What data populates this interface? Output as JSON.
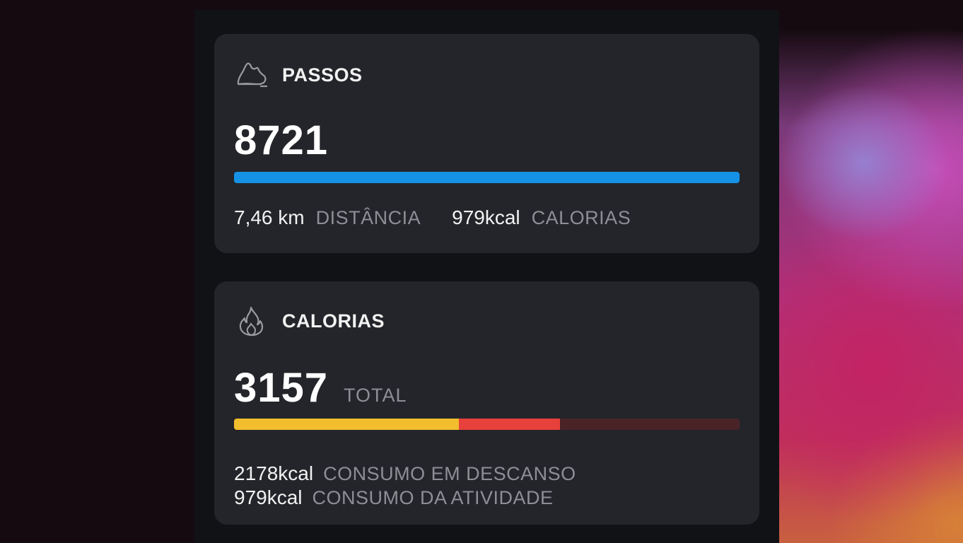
{
  "steps_card": {
    "icon": "shoe-icon",
    "title": "PASSOS",
    "value": "8721",
    "bar_color": "#1592e6",
    "bar_fill_fraction": 1.0,
    "distance_value": "7,46 km",
    "distance_label": "DISTÂNCIA",
    "calories_value": "979kcal",
    "calories_label": "CALORIAS"
  },
  "calories_card": {
    "icon": "flame-icon",
    "title": "CALORIAS",
    "value": "3157",
    "value_label": "TOTAL",
    "bar_segments": [
      {
        "name": "resting",
        "color": "#f2be2d",
        "fraction": 0.445
      },
      {
        "name": "activity",
        "color": "#e8403a",
        "fraction": 0.2
      }
    ],
    "bar_track_color": "#4a2326",
    "resting_value": "2178kcal",
    "resting_label": "CONSUMO EM DESCANSO",
    "activity_value": "979kcal",
    "activity_label": "CONSUMO DA ATIVIDADE"
  },
  "colors": {
    "card_bg": "#24252a",
    "screen_bg": "#111216",
    "text_primary": "#f2f2f2",
    "text_secondary": "#8e8f96"
  }
}
